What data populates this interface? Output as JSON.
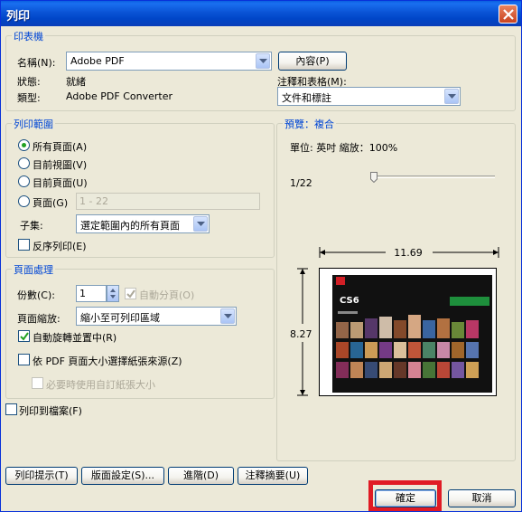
{
  "window": {
    "title": "列印"
  },
  "printer": {
    "group_label": "印表機",
    "name_label": "名稱(N):",
    "name_value": "Adobe PDF",
    "properties_button": "內容(P)",
    "status_label": "狀態:",
    "status_value": "就緒",
    "type_label": "類型:",
    "type_value": "Adobe PDF Converter",
    "comments_label": "注釋和表格(M):",
    "comments_value": "文件和標註"
  },
  "range": {
    "group_label": "列印範圍",
    "all_pages": "所有頁面(A)",
    "current_view": "目前視圖(V)",
    "current_page": "目前頁面(U)",
    "pages": "頁面(G)",
    "pages_value": "1 - 22",
    "subset_label": "子集:",
    "subset_value": "選定範圍內的所有頁面",
    "reverse": "反序列印(E)"
  },
  "handling": {
    "group_label": "頁面處理",
    "copies_label": "份數(C):",
    "copies_value": "1",
    "collate": "自動分頁(O)",
    "scaling_label": "頁面縮放:",
    "scaling_value": "縮小至可列印區域",
    "auto_rotate": "自動旋轉並置中(R)",
    "choose_source": "依 PDF 頁面大小選擇紙張來源(Z)",
    "custom_paper": "必要時使用自訂紙張大小"
  },
  "print_to_file": "列印到檔案(F)",
  "preview": {
    "group_label": "預覽：複合",
    "units": "單位: 英吋 縮放：100%",
    "page_indicator": "1/22",
    "width": "11.69",
    "height": "8.27",
    "thumb_title": "CS6",
    "slider_fraction": 0
  },
  "buttons": {
    "tips": "列印提示(T)",
    "page_setup": "版面設定(S)...",
    "advanced": "進階(D)",
    "summarize": "注釋摘要(U)",
    "ok": "確定",
    "cancel": "取消"
  },
  "colors": {
    "highlight": "#e01b24",
    "title_bar": "#0a54d6",
    "group_label": "#0046d5"
  }
}
